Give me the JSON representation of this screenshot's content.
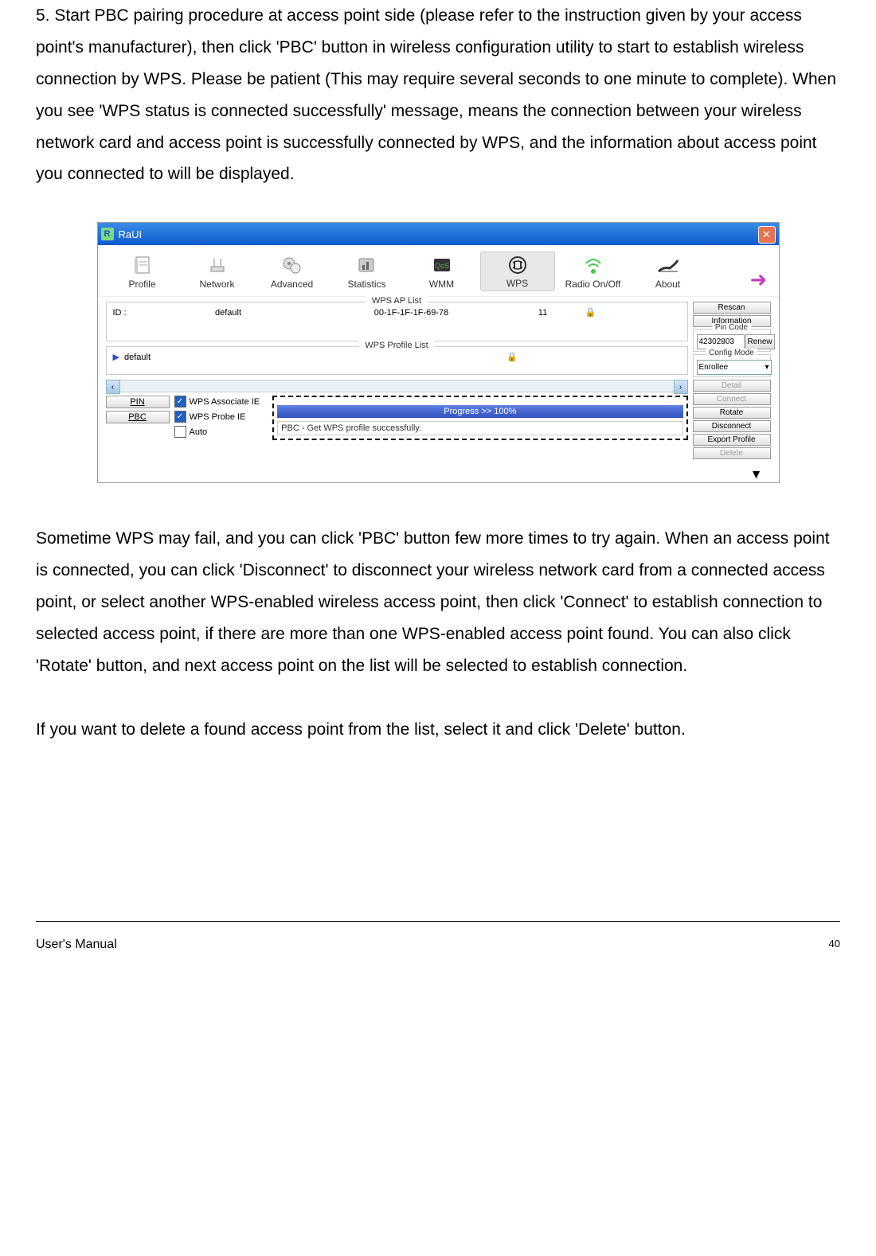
{
  "paragraphs": {
    "p1": "5. Start PBC pairing procedure at access point side (please refer to the instruction given by your access point's manufacturer), then click 'PBC' button in wireless configuration utility to start to establish wireless connection by WPS. Please be patient (This may require several seconds to one minute to complete). When you see 'WPS status is connected successfully' message, means the connection between your wireless network card and access point is successfully connected by WPS, and the information about access point you connected to will be displayed.",
    "p2": "Sometime WPS may fail, and you can click 'PBC' button few more times to try again. When an access point is connected, you can click 'Disconnect' to disconnect your wireless network card from a connected access point, or select another WPS-enabled wireless access point, then click 'Connect' to establish connection to selected access point, if there are more than one WPS-enabled access point found. You can also click 'Rotate' button, and next access point on the list will be selected to establish connection.",
    "p3": "If you want to delete a found access point from the list, select it and click 'Delete' button."
  },
  "app": {
    "title": "RaUI",
    "close": "✕"
  },
  "toolbar": {
    "profile": "Profile",
    "network": "Network",
    "advanced": "Advanced",
    "statistics": "Statistics",
    "wmm": "WMM",
    "wps": "WPS",
    "radio": "Radio On/Off",
    "about": "About"
  },
  "wps_ap_list": {
    "label": "WPS AP List",
    "id_label": "ID :",
    "ssid": "default",
    "mac": "00-1F-1F-1F-69-78",
    "channel": "11"
  },
  "wps_profile_list": {
    "label": "WPS Profile List",
    "name": "default"
  },
  "side": {
    "rescan": "Rescan",
    "information": "Information",
    "pincode_label": "Pin Code",
    "pincode": "42302803",
    "renew": "Renew",
    "configmode_label": "Config Mode",
    "configmode": "Enrollee",
    "detail": "Detail",
    "connect": "Connect",
    "rotate": "Rotate",
    "disconnect": "Disconnect",
    "export": "Export Profile",
    "delete": "Delete"
  },
  "controls": {
    "pin": "PIN",
    "pbc": "PBC",
    "assoc_ie": "WPS Associate IE",
    "probe_ie": "WPS Probe IE",
    "auto": "Auto"
  },
  "progress": {
    "text": "Progress >> 100%",
    "status": "PBC - Get WPS profile successfully."
  },
  "footer": {
    "title": "User's Manual",
    "page": "40"
  }
}
